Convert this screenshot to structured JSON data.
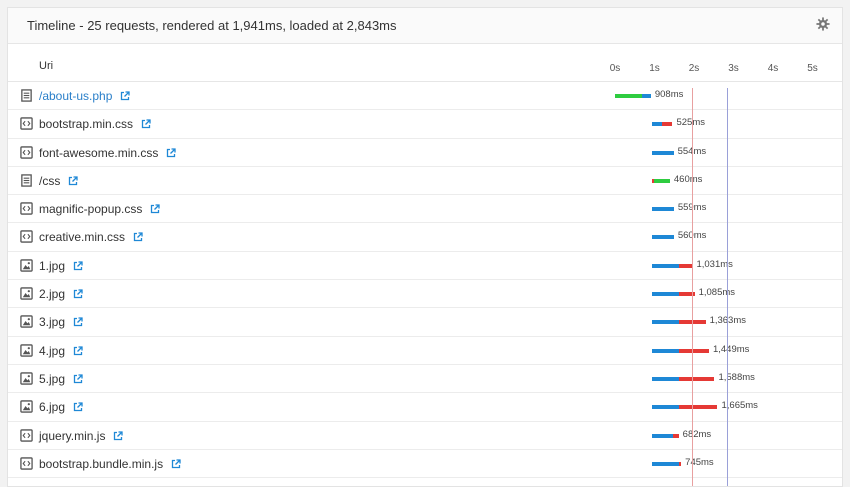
{
  "title": "Timeline - 25 requests, rendered at 1,941ms, loaded at 2,843ms",
  "column_header": "Uri",
  "ticks": [
    "0s",
    "1s",
    "2s",
    "3s",
    "4s",
    "5s"
  ],
  "markers": {
    "rendered_ms": 1941,
    "loaded_ms": 2843,
    "rendered_color": "#e8a0a0",
    "loaded_color": "#9aa0d8"
  },
  "colors": {
    "blocking": "#2ecc40",
    "waiting": "#1e88d6",
    "receiving": "#e53935",
    "link": "#2a7fc9"
  },
  "requests": [
    {
      "name": "/about-us.php",
      "type": "document",
      "link": true,
      "duration_label": "908ms",
      "segments": [
        {
          "start": 0,
          "end": 690,
          "kind": "blocking"
        },
        {
          "start": 690,
          "end": 908,
          "kind": "waiting"
        }
      ]
    },
    {
      "name": "bootstrap.min.css",
      "type": "code",
      "link": false,
      "duration_label": "525ms",
      "segments": [
        {
          "start": 930,
          "end": 1180,
          "kind": "waiting"
        },
        {
          "start": 1180,
          "end": 1455,
          "kind": "receiving"
        }
      ]
    },
    {
      "name": "font-awesome.min.css",
      "type": "code",
      "link": false,
      "duration_label": "554ms",
      "segments": [
        {
          "start": 930,
          "end": 1484,
          "kind": "waiting"
        }
      ]
    },
    {
      "name": "/css",
      "type": "document",
      "link": false,
      "duration_label": "460ms",
      "segments": [
        {
          "start": 930,
          "end": 980,
          "kind": "receiving"
        },
        {
          "start": 980,
          "end": 1390,
          "kind": "blocking"
        }
      ]
    },
    {
      "name": "magnific-popup.css",
      "type": "code",
      "link": false,
      "duration_label": "559ms",
      "segments": [
        {
          "start": 930,
          "end": 1489,
          "kind": "waiting"
        }
      ]
    },
    {
      "name": "creative.min.css",
      "type": "code",
      "link": false,
      "duration_label": "560ms",
      "segments": [
        {
          "start": 930,
          "end": 1490,
          "kind": "waiting"
        }
      ]
    },
    {
      "name": "1.jpg",
      "type": "image",
      "link": false,
      "duration_label": "1,031ms",
      "segments": [
        {
          "start": 930,
          "end": 1620,
          "kind": "waiting"
        },
        {
          "start": 1620,
          "end": 1961,
          "kind": "receiving"
        }
      ]
    },
    {
      "name": "2.jpg",
      "type": "image",
      "link": false,
      "duration_label": "1,085ms",
      "segments": [
        {
          "start": 930,
          "end": 1620,
          "kind": "waiting"
        },
        {
          "start": 1620,
          "end": 2015,
          "kind": "receiving"
        }
      ]
    },
    {
      "name": "3.jpg",
      "type": "image",
      "link": false,
      "duration_label": "1,363ms",
      "segments": [
        {
          "start": 930,
          "end": 1620,
          "kind": "waiting"
        },
        {
          "start": 1620,
          "end": 2293,
          "kind": "receiving"
        }
      ]
    },
    {
      "name": "4.jpg",
      "type": "image",
      "link": false,
      "duration_label": "1,449ms",
      "segments": [
        {
          "start": 930,
          "end": 1620,
          "kind": "waiting"
        },
        {
          "start": 1620,
          "end": 2379,
          "kind": "receiving"
        }
      ]
    },
    {
      "name": "5.jpg",
      "type": "image",
      "link": false,
      "duration_label": "1,588ms",
      "segments": [
        {
          "start": 930,
          "end": 1620,
          "kind": "waiting"
        },
        {
          "start": 1620,
          "end": 2518,
          "kind": "receiving"
        }
      ]
    },
    {
      "name": "6.jpg",
      "type": "image",
      "link": false,
      "duration_label": "1,665ms",
      "segments": [
        {
          "start": 930,
          "end": 1620,
          "kind": "waiting"
        },
        {
          "start": 1620,
          "end": 2595,
          "kind": "receiving"
        }
      ]
    },
    {
      "name": "jquery.min.js",
      "type": "code",
      "link": false,
      "duration_label": "682ms",
      "segments": [
        {
          "start": 930,
          "end": 1480,
          "kind": "waiting"
        },
        {
          "start": 1480,
          "end": 1612,
          "kind": "receiving"
        }
      ]
    },
    {
      "name": "bootstrap.bundle.min.js",
      "type": "code",
      "link": false,
      "duration_label": "745ms",
      "segments": [
        {
          "start": 930,
          "end": 1620,
          "kind": "waiting"
        },
        {
          "start": 1620,
          "end": 1675,
          "kind": "receiving"
        }
      ]
    }
  ]
}
